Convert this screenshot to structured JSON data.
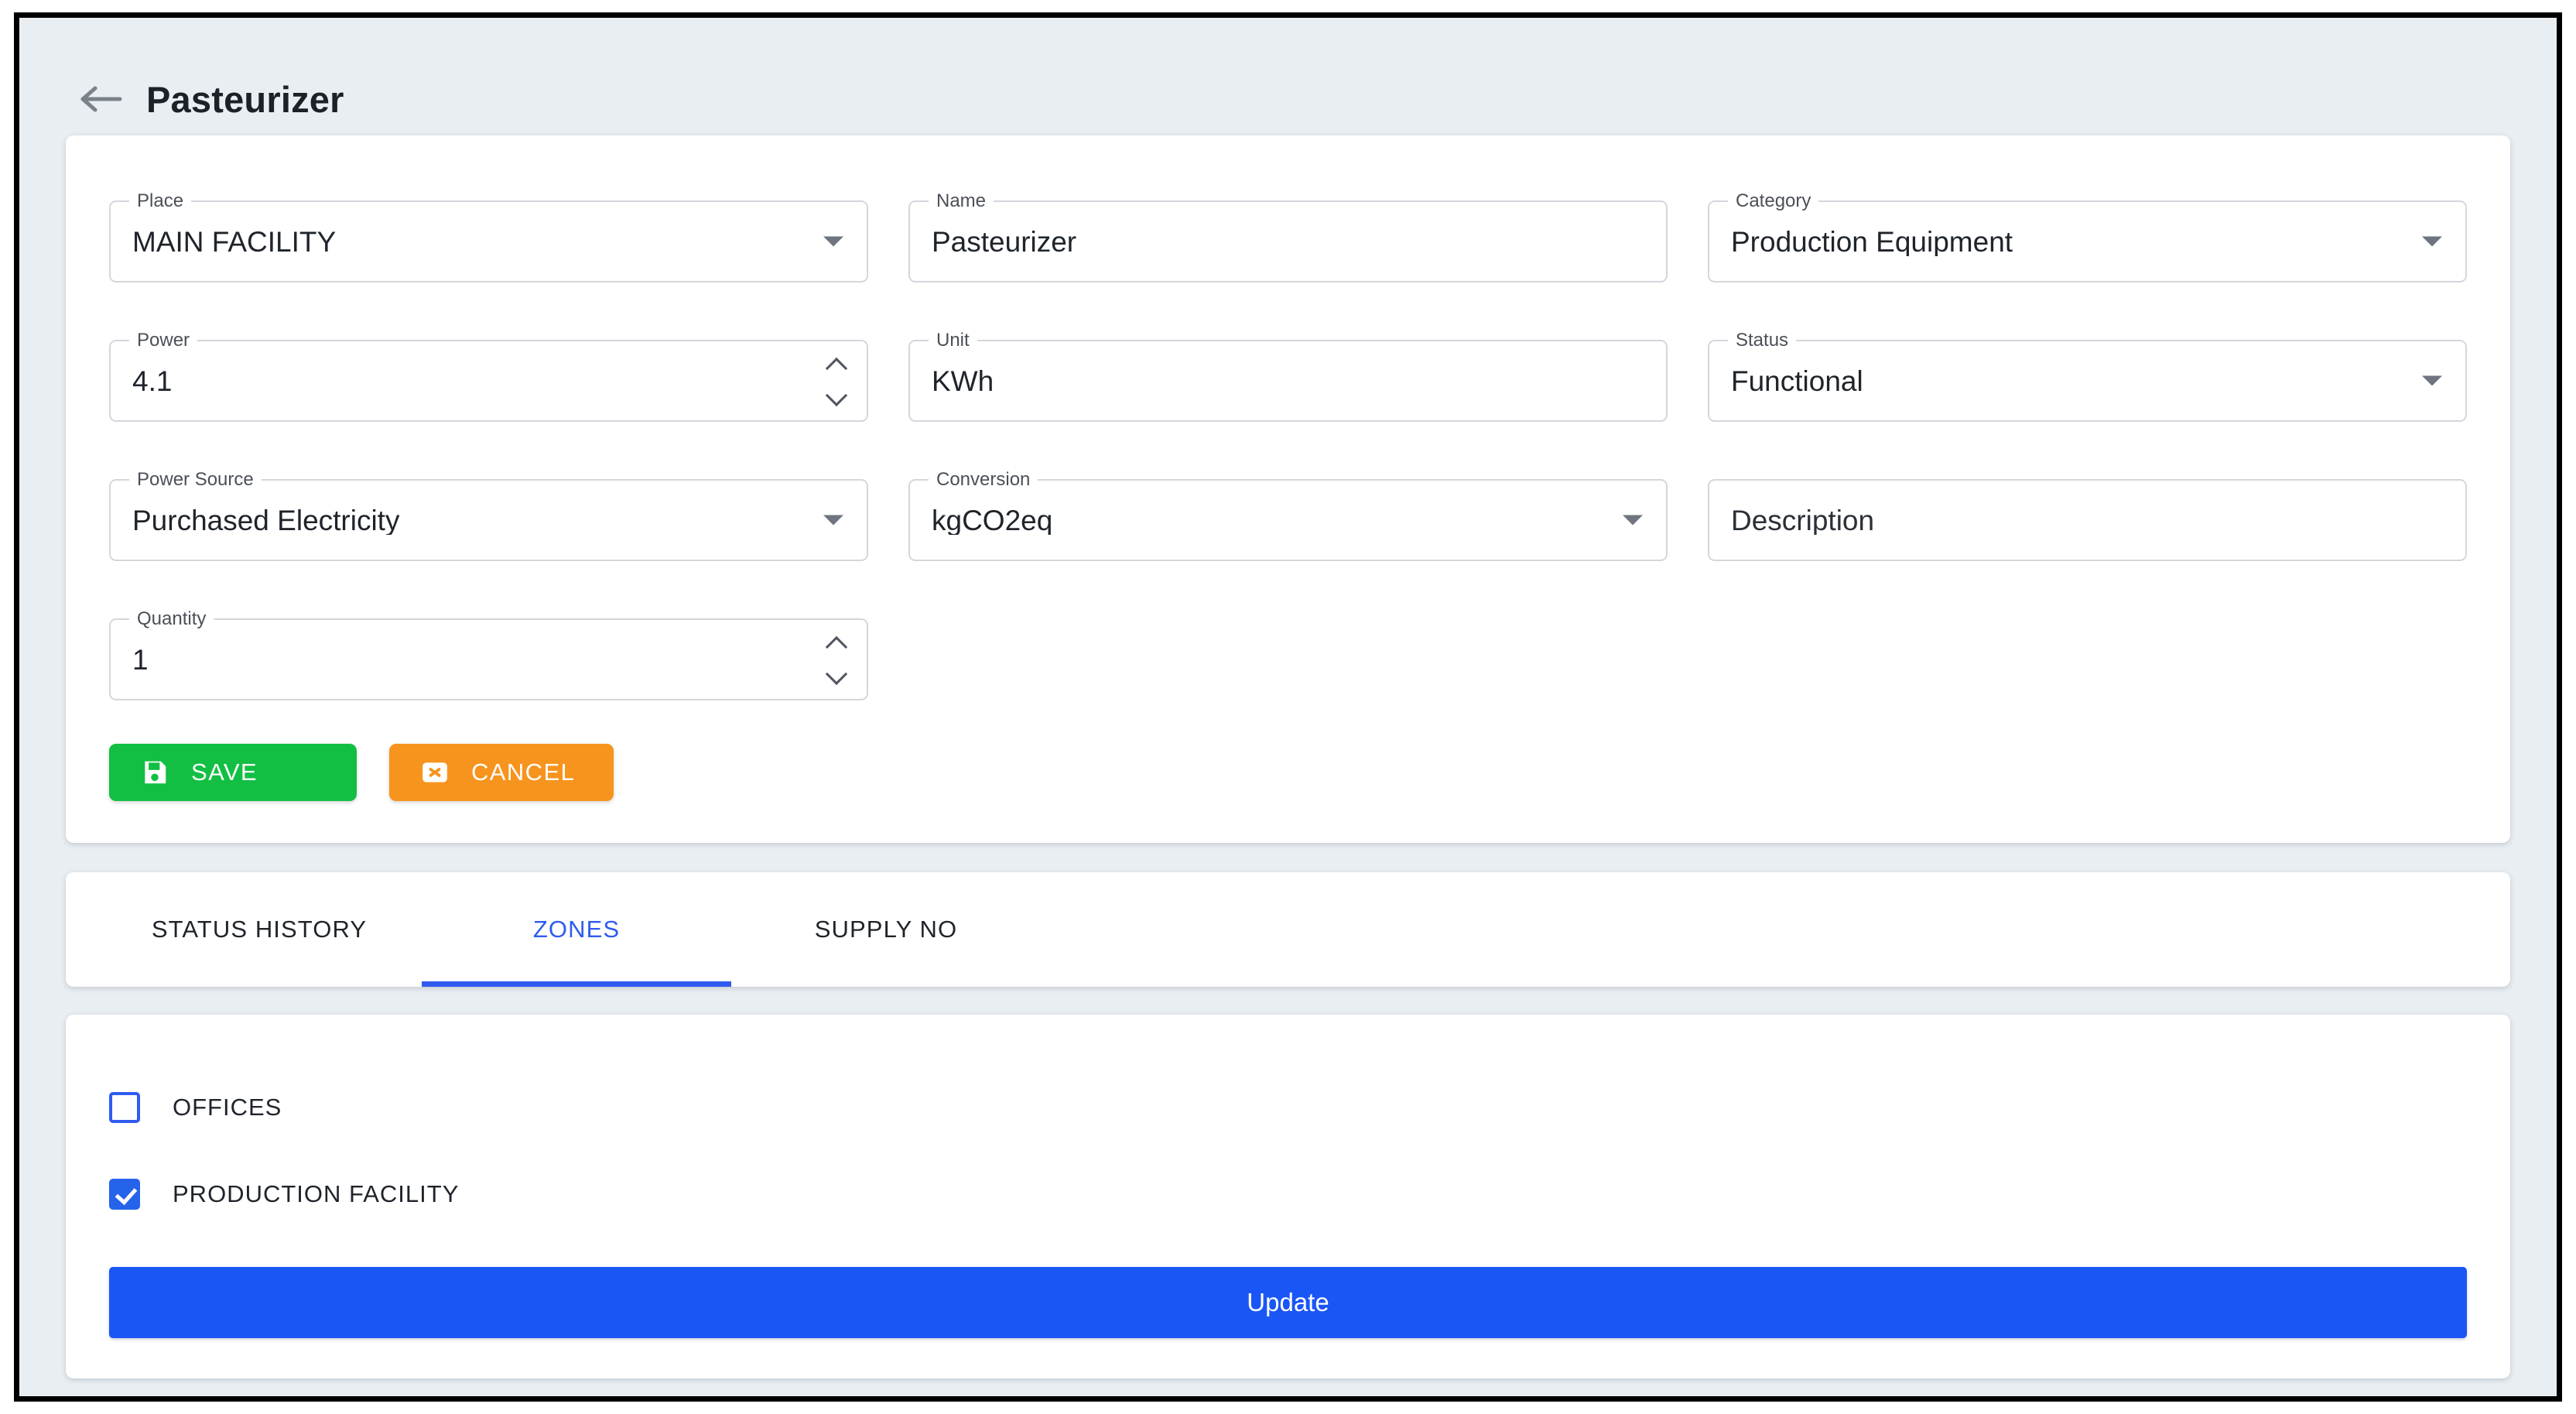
{
  "header": {
    "back_icon": "arrow-left-icon",
    "title": "Pasteurizer"
  },
  "form": {
    "fields": [
      {
        "label": "Place",
        "value": "MAIN FACILITY",
        "control": "select"
      },
      {
        "label": "Name",
        "value": "Pasteurizer",
        "control": "text"
      },
      {
        "label": "Category",
        "value": "Production Equipment",
        "control": "select"
      },
      {
        "label": "Power",
        "value": "4.1",
        "control": "number"
      },
      {
        "label": "Unit",
        "value": "KWh",
        "control": "text"
      },
      {
        "label": "Status",
        "value": "Functional",
        "control": "select"
      },
      {
        "label": "Power Source",
        "value": "Purchased Electricity",
        "control": "select"
      },
      {
        "label": "Conversion",
        "value": "kgCO2eq",
        "control": "select"
      },
      {
        "label": "",
        "value": "Description",
        "control": "text-placeholder"
      },
      {
        "label": "Quantity",
        "value": "1",
        "control": "number"
      }
    ],
    "buttons": {
      "save_label": "SAVE",
      "save_icon": "save-disk-icon",
      "save_color": "#12bf43",
      "cancel_label": "CANCEL",
      "cancel_icon": "cancel-x-icon",
      "cancel_color": "#f7941d"
    }
  },
  "tabs": {
    "items": [
      {
        "label": "STATUS HISTORY",
        "active": false
      },
      {
        "label": "ZONES",
        "active": true
      },
      {
        "label": "SUPPLY NO",
        "active": false
      }
    ],
    "active_color": "#2f5bf0"
  },
  "zones": {
    "items": [
      {
        "label": "OFFICES",
        "checked": false
      },
      {
        "label": "PRODUCTION FACILITY",
        "checked": true
      }
    ],
    "update_label": "Update",
    "update_color": "#1a55f5"
  }
}
